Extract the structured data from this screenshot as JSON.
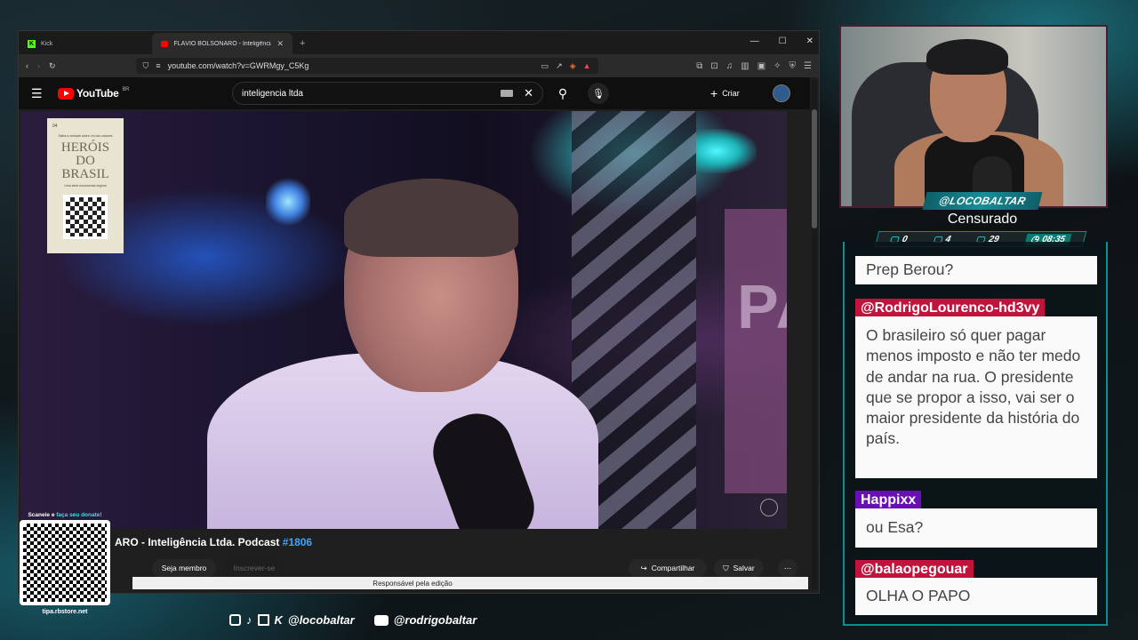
{
  "browser": {
    "tabs": [
      {
        "label": "Kick",
        "active": false
      },
      {
        "label": "FLÁVIO BOLSONARO - Inteligência Ltd.",
        "active": true
      }
    ],
    "url": "youtube.com/watch?v=GWRMgy_C5Kg"
  },
  "youtube": {
    "logo_text": "YouTube",
    "region": "BR",
    "search_value": "inteligencia ltda",
    "create_label": "Criar",
    "video_title_main": "ARO - Inteligência Ltda. Podcast",
    "video_title_tag": "#1806",
    "member_label": "Seja membro",
    "subscribe_label": "Inscrever-se",
    "share_label": "Compartilhar",
    "save_label": "Salvar",
    "editor_note": "Responsável pela edição"
  },
  "promo": {
    "number": "04",
    "tagline": "Saiba a verdade sobre um dos maiores",
    "title": "HERÓIS DO BRASIL",
    "subtitle": "Uma série documental original"
  },
  "video_sign_text": "PA",
  "stream": {
    "handle": "@LOCOBALTAR",
    "status": "Censurado",
    "stats": {
      "chat": "0",
      "video": "4",
      "viewers": "29",
      "time": "08:35"
    }
  },
  "chat": [
    {
      "user": "",
      "text": "Prep Berou?"
    },
    {
      "user": "@RodrigoLourenco-hd3vy",
      "user_color": "#c0143c",
      "text": "O brasileiro só quer pagar menos imposto e não ter medo de andar na rua. O presidente que se propor a isso, vai ser o maior presidente da história do país."
    },
    {
      "user": "Happixx",
      "user_color": "#6a0fb3",
      "text": "ou Esa?"
    },
    {
      "user": "@balaopegouar",
      "user_color": "#c0143c",
      "text": "OLHA O PAPO"
    }
  ],
  "overlay": {
    "qr_label_prefix": "Scaneie e ",
    "qr_label_highlight": "faça seu donate!",
    "qr_site": "tipa.rbstore.net",
    "social_handle_1": "@locobaltar",
    "social_handle_2": "@rodrigobaltar"
  },
  "colors": {
    "accent": "#0b8d95",
    "yt_red": "#ff0000",
    "link_blue": "#3ea6ff"
  }
}
